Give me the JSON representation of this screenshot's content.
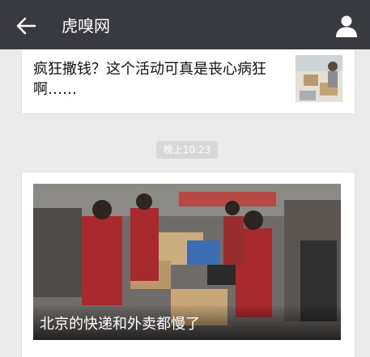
{
  "header": {
    "title": "虎嗅网",
    "back_icon": "arrow-left-icon",
    "profile_icon": "user-icon",
    "bg_color": "#393a3f"
  },
  "messages": [
    {
      "type": "article",
      "title": "疯狂撒钱？这个活动可真是丧心病狂啊……",
      "thumbnail": "people-holding-boxes-photo"
    },
    {
      "type": "timestamp",
      "text": "晚上10:23"
    },
    {
      "type": "article-cover",
      "cover_caption": "北京的快递和外卖都慢了",
      "cover_image": "couriers-sorting-packages-photo"
    }
  ]
}
